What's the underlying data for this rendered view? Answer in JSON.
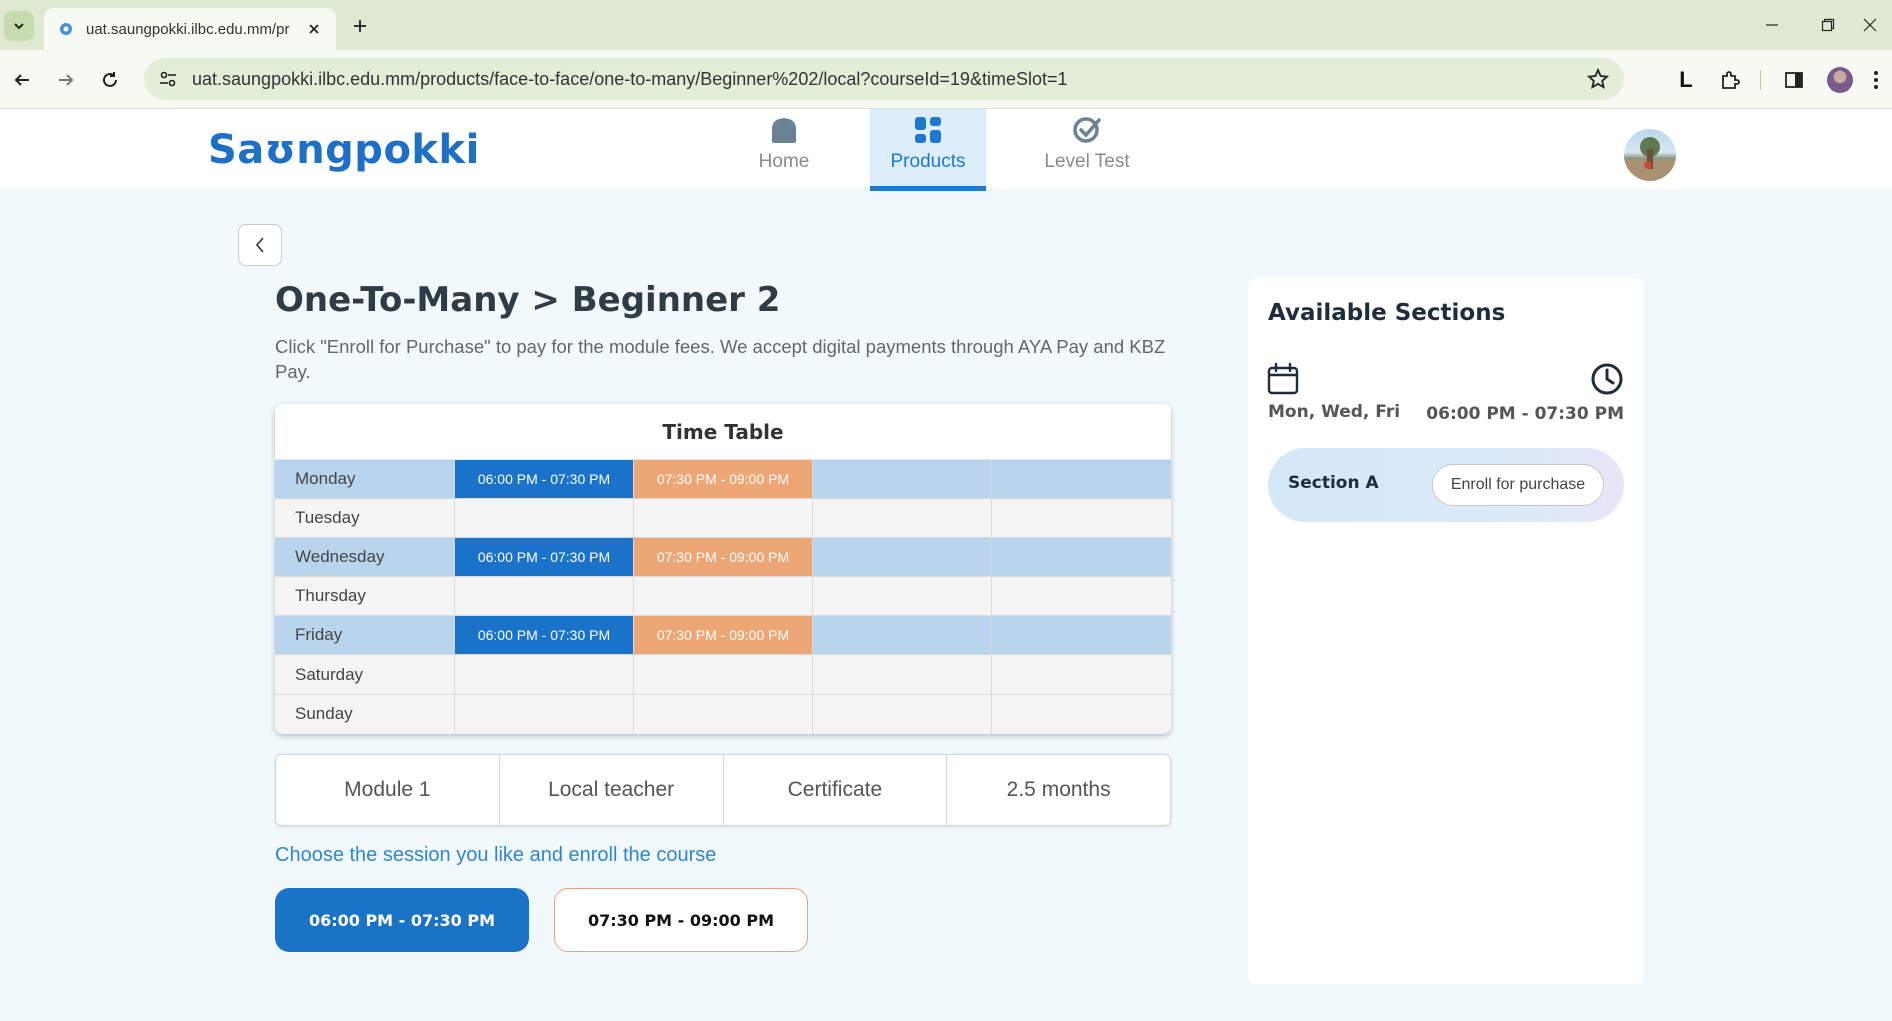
{
  "browser": {
    "tab_title": "uat.saungpokki.ilbc.edu.mm/pr",
    "url": "uat.saungpokki.ilbc.edu.mm/products/face-to-face/one-to-many/Beginner%202/local?courseId=19&timeSlot=1",
    "extension_letter": "L"
  },
  "header": {
    "logo": "Saʊngpokki",
    "nav": [
      {
        "label": "Home",
        "icon": "home-icon"
      },
      {
        "label": "Products",
        "icon": "grid-icon",
        "active": true
      },
      {
        "label": "Level Test",
        "icon": "check-circle-icon"
      }
    ]
  },
  "main": {
    "title": "One-To-Many > Beginner 2",
    "description": "Click \"Enroll for Purchase\" to pay for the module fees. We accept digital payments through AYA Pay and KBZ Pay.",
    "timetable": {
      "title": "Time Table",
      "rows": [
        {
          "day": "Monday",
          "slot1": "06:00 PM - 07:30 PM",
          "slot2": "07:30 PM - 09:00 PM"
        },
        {
          "day": "Tuesday"
        },
        {
          "day": "Wednesday",
          "slot1": "06:00 PM - 07:30 PM",
          "slot2": "07:30 PM - 09:00 PM"
        },
        {
          "day": "Thursday"
        },
        {
          "day": "Friday",
          "slot1": "06:00 PM - 07:30 PM",
          "slot2": "07:30 PM - 09:00 PM"
        },
        {
          "day": "Saturday"
        },
        {
          "day": "Sunday"
        }
      ]
    },
    "info": [
      "Module 1",
      "Local teacher",
      "Certificate",
      "2.5 months"
    ],
    "choose_text": "Choose the session you like and enroll the course",
    "sessions": [
      "06:00 PM - 07:30 PM",
      "07:30 PM - 09:00 PM"
    ]
  },
  "sidebar": {
    "title": "Available Sections",
    "days": "Mon, Wed, Fri",
    "time": "06:00 PM - 07:30 PM",
    "section": {
      "name": "Section A",
      "button": "Enroll for purchase"
    }
  },
  "colors": {
    "primary": "#1b73c8",
    "accent_orange": "#eda676",
    "highlight_row": "#b9d5ed",
    "page_bg": "#f2f9fd"
  }
}
